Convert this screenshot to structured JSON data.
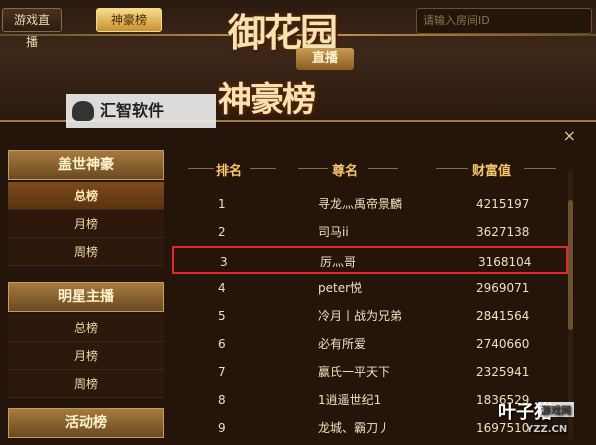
{
  "topbar": {
    "live_btn": "游戏直播",
    "rich_btn": "神豪榜",
    "search_placeholder": "请输入房间ID"
  },
  "art": {
    "title_top": "御花园",
    "title_tag": "直播",
    "title_mid": "神豪榜"
  },
  "watermark": {
    "text": "汇智软件"
  },
  "close_label": "×",
  "sidebar": {
    "groups": [
      {
        "title": "盖世神豪",
        "items": [
          "总榜",
          "月榜",
          "周榜"
        ]
      },
      {
        "title": "明星主播",
        "items": [
          "总榜",
          "月榜",
          "周榜"
        ]
      },
      {
        "title": "活动榜",
        "items": []
      }
    ]
  },
  "table": {
    "headers": {
      "rank": "排名",
      "name": "尊名",
      "wealth": "财富值"
    },
    "rows": [
      {
        "rank": "1",
        "name": "寻龙灬禹帝景麟",
        "wealth": "4215197"
      },
      {
        "rank": "2",
        "name": "司马ii",
        "wealth": "3627138"
      },
      {
        "rank": "3",
        "name": "厉灬哥",
        "wealth": "3168104"
      },
      {
        "rank": "4",
        "name": "peter悦",
        "wealth": "2969071"
      },
      {
        "rank": "5",
        "name": "冷月丨战为兄弟",
        "wealth": "2841564"
      },
      {
        "rank": "6",
        "name": "必有所爱",
        "wealth": "2740660"
      },
      {
        "rank": "7",
        "name": "赢氏一平天下",
        "wealth": "2325941"
      },
      {
        "rank": "8",
        "name": "1逍遥世纪1",
        "wealth": "1836529"
      },
      {
        "rank": "9",
        "name": "龙城、霸刀丿",
        "wealth": "1697510"
      }
    ]
  },
  "corner_watermark": {
    "main": "叶子猪",
    "tag": "游戏网",
    "url": "YZZ.CN"
  }
}
